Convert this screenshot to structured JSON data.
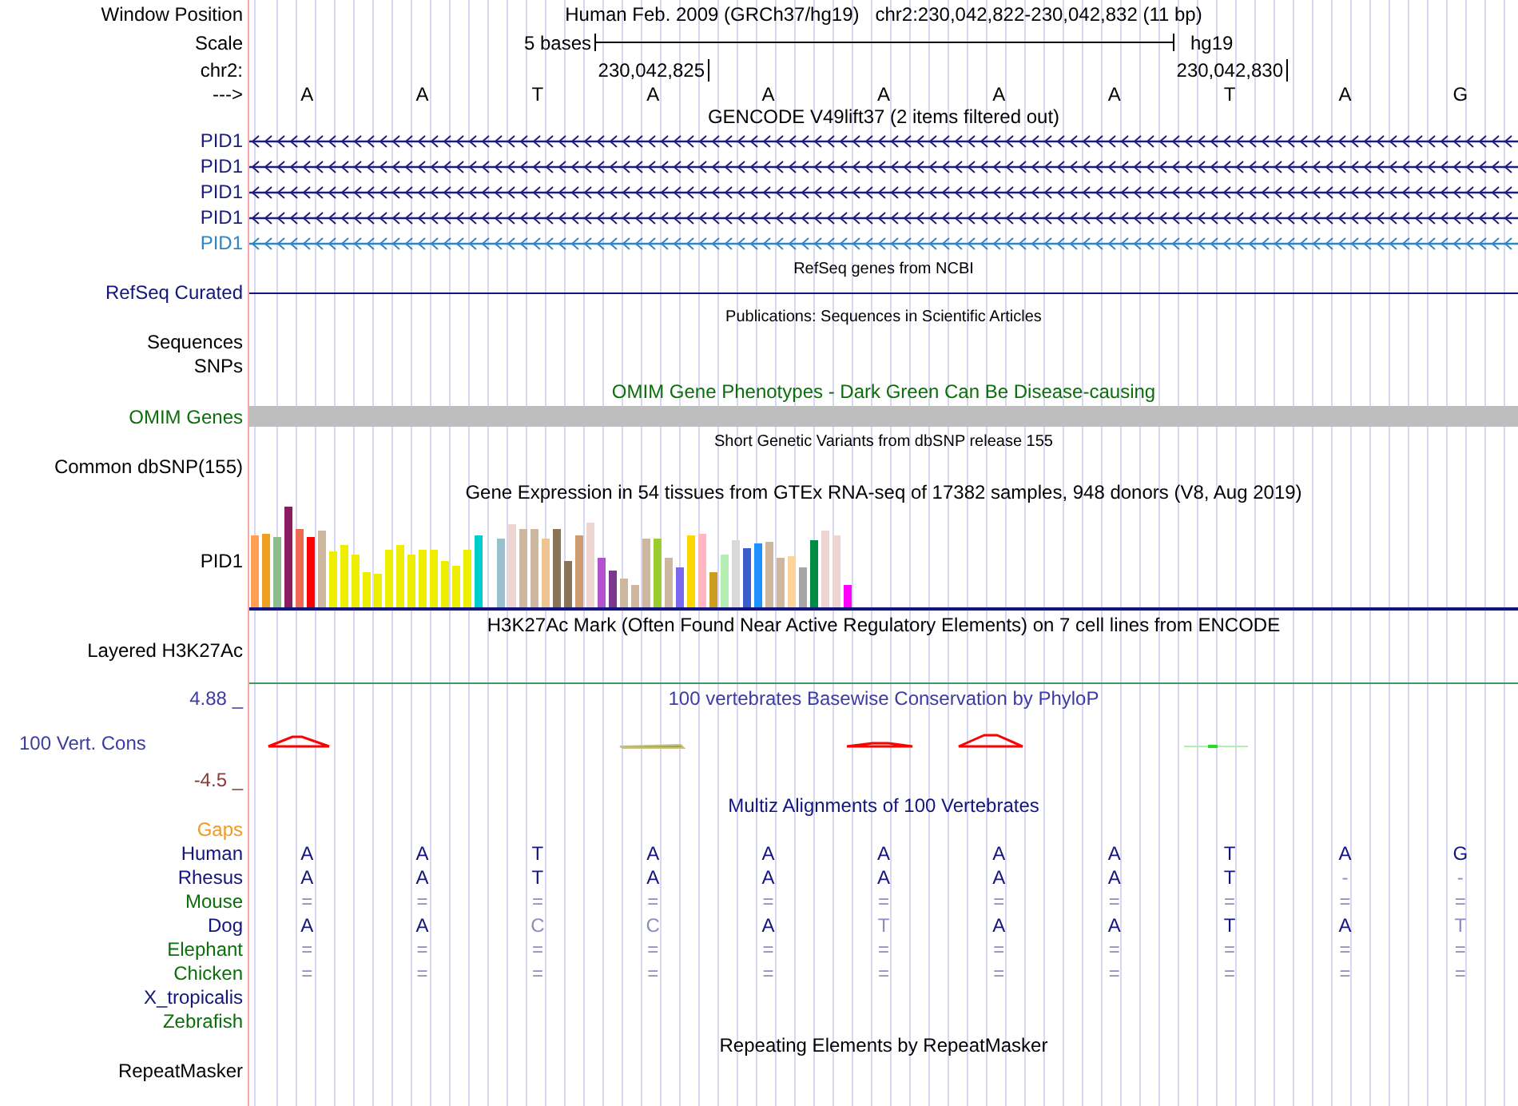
{
  "position": {
    "label": "Window Position",
    "assembly": "Human Feb. 2009 (GRCh37/hg19)",
    "range": "chr2:230,042,822-230,042,832 (11 bp)"
  },
  "scale": {
    "label": "Scale",
    "span": "5 bases",
    "assembly": "hg19"
  },
  "coords": {
    "label": "chr2:",
    "ticks": [
      "230,042,825",
      "230,042,830"
    ]
  },
  "sequence": {
    "label": "--->",
    "bases": [
      "A",
      "A",
      "T",
      "A",
      "A",
      "A",
      "A",
      "A",
      "T",
      "A",
      "G"
    ]
  },
  "gencode": {
    "title": "GENCODE V49lift37 (2 items filtered out)",
    "items": [
      {
        "name": "PID1",
        "color": "#1c1c7c"
      },
      {
        "name": "PID1",
        "color": "#1c1c7c"
      },
      {
        "name": "PID1",
        "color": "#1c1c7c"
      },
      {
        "name": "PID1",
        "color": "#1c1c7c"
      },
      {
        "name": "PID1",
        "color": "#2c86c4"
      }
    ]
  },
  "refseq": {
    "title": "RefSeq genes from NCBI",
    "label": "RefSeq Curated"
  },
  "publications": {
    "title": "Publications: Sequences in Scientific Articles",
    "labels": [
      "Sequences",
      "SNPs"
    ]
  },
  "omim": {
    "title": "OMIM Gene Phenotypes - Dark Green Can Be Disease-causing",
    "label": "OMIM Genes"
  },
  "dbsnp": {
    "title": "Short Genetic Variants from dbSNP release 155",
    "label": "Common dbSNP(155)"
  },
  "gtex": {
    "title": "Gene Expression in 54 tissues from GTEx RNA-seq of 17382 samples, 948 donors (V8, Aug 2019)",
    "label": "PID1"
  },
  "h3k27ac": {
    "title": "H3K27Ac Mark (Often Found Near Active Regulatory Elements) on 7 cell lines from ENCODE",
    "label": "Layered H3K27Ac"
  },
  "phylop": {
    "title": "100 vertebrates Basewise Conservation by PhyloP",
    "label": "100 Vert. Cons",
    "max": "4.88 _",
    "min": "-4.5 _"
  },
  "multiz": {
    "title": "Multiz Alignments of 100 Vertebrates",
    "gaps_label": "Gaps",
    "species": [
      {
        "name": "Human",
        "color": "#14147e",
        "bases": [
          {
            "base": "A",
            "dim": false
          },
          {
            "base": "A",
            "dim": false
          },
          {
            "base": "T",
            "dim": false
          },
          {
            "base": "A",
            "dim": false
          },
          {
            "base": "A",
            "dim": false
          },
          {
            "base": "A",
            "dim": false
          },
          {
            "base": "A",
            "dim": false
          },
          {
            "base": "A",
            "dim": false
          },
          {
            "base": "T",
            "dim": false
          },
          {
            "base": "A",
            "dim": false
          },
          {
            "base": "G",
            "dim": false
          }
        ]
      },
      {
        "name": "Rhesus",
        "color": "#14147e",
        "bases": [
          {
            "base": "A",
            "dim": false
          },
          {
            "base": "A",
            "dim": false
          },
          {
            "base": "T",
            "dim": false
          },
          {
            "base": "A",
            "dim": false
          },
          {
            "base": "A",
            "dim": false
          },
          {
            "base": "A",
            "dim": false
          },
          {
            "base": "A",
            "dim": false
          },
          {
            "base": "A",
            "dim": false
          },
          {
            "base": "T",
            "dim": false
          },
          {
            "base": "-",
            "dim": true
          },
          {
            "base": "-",
            "dim": true
          }
        ]
      },
      {
        "name": "Mouse",
        "color": "#0b6e0b",
        "bases": [
          {
            "base": "=",
            "dim": true
          },
          {
            "base": "=",
            "dim": true
          },
          {
            "base": "=",
            "dim": true
          },
          {
            "base": "=",
            "dim": true
          },
          {
            "base": "=",
            "dim": true
          },
          {
            "base": "=",
            "dim": true
          },
          {
            "base": "=",
            "dim": true
          },
          {
            "base": "=",
            "dim": true
          },
          {
            "base": "=",
            "dim": true
          },
          {
            "base": "=",
            "dim": true
          },
          {
            "base": "=",
            "dim": true
          }
        ]
      },
      {
        "name": "Dog",
        "color": "#14147e",
        "bases": [
          {
            "base": "A",
            "dim": false
          },
          {
            "base": "A",
            "dim": false
          },
          {
            "base": "C",
            "dim": true
          },
          {
            "base": "C",
            "dim": true
          },
          {
            "base": "A",
            "dim": false
          },
          {
            "base": "T",
            "dim": true
          },
          {
            "base": "A",
            "dim": false
          },
          {
            "base": "A",
            "dim": false
          },
          {
            "base": "T",
            "dim": false
          },
          {
            "base": "A",
            "dim": false
          },
          {
            "base": "T",
            "dim": true
          }
        ]
      },
      {
        "name": "Elephant",
        "color": "#0b6e0b",
        "bases": [
          {
            "base": "=",
            "dim": true
          },
          {
            "base": "=",
            "dim": true
          },
          {
            "base": "=",
            "dim": true
          },
          {
            "base": "=",
            "dim": true
          },
          {
            "base": "=",
            "dim": true
          },
          {
            "base": "=",
            "dim": true
          },
          {
            "base": "=",
            "dim": true
          },
          {
            "base": "=",
            "dim": true
          },
          {
            "base": "=",
            "dim": true
          },
          {
            "base": "=",
            "dim": true
          },
          {
            "base": "=",
            "dim": true
          }
        ]
      },
      {
        "name": "Chicken",
        "color": "#0b6e0b",
        "bases": [
          {
            "base": "=",
            "dim": true
          },
          {
            "base": "=",
            "dim": true
          },
          {
            "base": "=",
            "dim": true
          },
          {
            "base": "=",
            "dim": true
          },
          {
            "base": "=",
            "dim": true
          },
          {
            "base": "=",
            "dim": true
          },
          {
            "base": "=",
            "dim": true
          },
          {
            "base": "=",
            "dim": true
          },
          {
            "base": "=",
            "dim": true
          },
          {
            "base": "=",
            "dim": true
          },
          {
            "base": "=",
            "dim": true
          }
        ]
      },
      {
        "name": "X_tropicalis",
        "color": "#14147e"
      },
      {
        "name": "Zebrafish",
        "color": "#0b6e0b"
      }
    ]
  },
  "repeatmasker": {
    "title": "Repeating Elements by RepeatMasker",
    "label": "RepeatMasker"
  }
}
